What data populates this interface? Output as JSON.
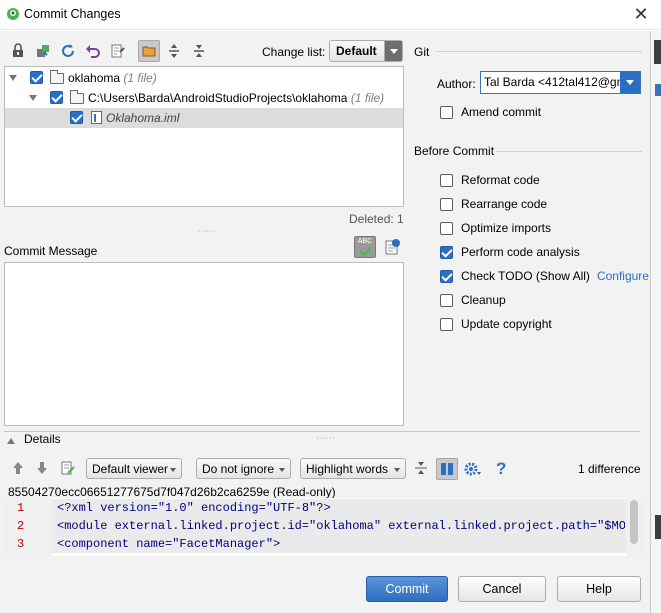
{
  "window": {
    "title": "Commit Changes",
    "close_glyph": "✕"
  },
  "toolbar": {
    "change_list_label": "Change list:",
    "change_list_value": "Default",
    "icons": [
      "vcs-update-icon",
      "move-icon",
      "refresh-icon",
      "rollback-icon",
      "show-diff-icon",
      "group-by-directory-icon",
      "expand-all-icon",
      "collapse-all-icon"
    ]
  },
  "tree": {
    "rows": [
      {
        "name": "oklahoma",
        "meta": "(1 file)"
      },
      {
        "name": "C:\\Users\\Barda\\AndroidStudioProjects\\oklahoma",
        "meta": "(1 file)"
      },
      {
        "name": "Oklahoma.iml",
        "meta": ""
      }
    ],
    "deleted_status": "Deleted: 1"
  },
  "commit_message": {
    "label": "Commit Message",
    "value": "",
    "spellcheck_text": "ABC"
  },
  "git": {
    "section_title": "Git",
    "author_label": "Author:",
    "author_value": "Tal Barda <412tal412@gm",
    "amend_label": "Amend commit",
    "amend_checked": false
  },
  "before_commit": {
    "section_title": "Before Commit",
    "options": [
      {
        "label": "Reformat code",
        "checked": false
      },
      {
        "label": "Rearrange code",
        "checked": false
      },
      {
        "label": "Optimize imports",
        "checked": false
      },
      {
        "label": "Perform code analysis",
        "checked": true
      },
      {
        "label": "Check TODO (Show All)",
        "checked": true,
        "link": "Configure"
      },
      {
        "label": "Cleanup",
        "checked": false
      },
      {
        "label": "Update copyright",
        "checked": false
      }
    ]
  },
  "details": {
    "label": "Details",
    "viewer": "Default viewer",
    "ignore": "Do not ignore",
    "highlight": "Highlight words",
    "difference_count": "1 difference",
    "file_header": "85504270ecc06651277675d7f047d26b2ca6259e (Read-only)",
    "lines": [
      {
        "no": "1",
        "text": "<?xml version=\"1.0\" encoding=\"UTF-8\"?>"
      },
      {
        "no": "2",
        "text": "<module external.linked.project.id=\"oklahoma\" external.linked.project.path=\"$MODU"
      },
      {
        "no": "3",
        "text": "  <component name=\"FacetManager\">"
      }
    ]
  },
  "buttons": {
    "commit": "Commit",
    "cancel": "Cancel",
    "help": "Help"
  }
}
